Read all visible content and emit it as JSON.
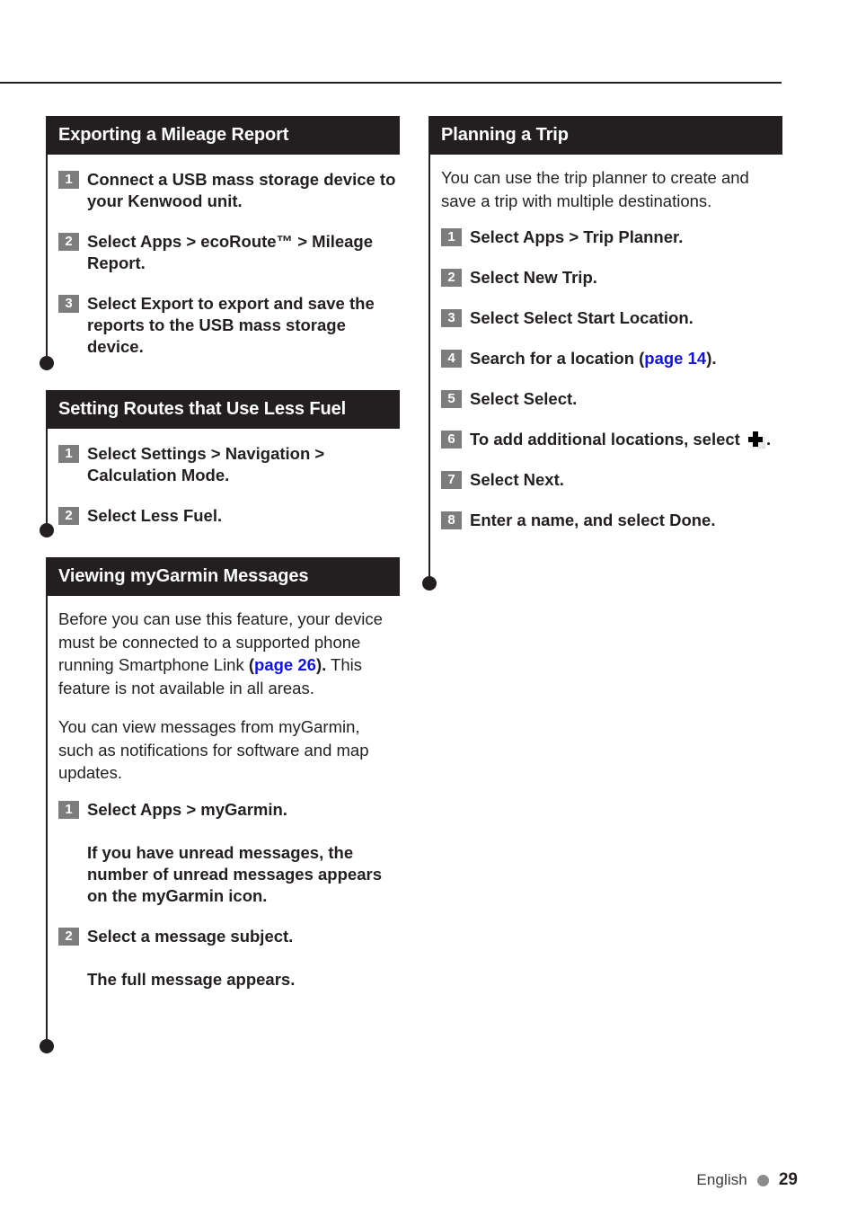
{
  "page": {
    "footer_language": "English",
    "footer_page_number": "29",
    "accent_link_color": "#1414d2",
    "header_bar_color": "#231f20",
    "step_badge_color": "#7d7d7d",
    "footer_dot_color": "#8c8c8c"
  },
  "left_column": {
    "sections": [
      {
        "title": "Exporting a Mileage Report",
        "steps": [
          {
            "num": "1",
            "text": "Connect a USB mass storage device to your Kenwood unit."
          },
          {
            "num": "2",
            "text": "Select Apps > ecoRoute™ > Mileage Report."
          },
          {
            "num": "3",
            "text": "Select Export to export and save the reports to the USB mass storage device."
          }
        ]
      },
      {
        "title": "Setting Routes that Use Less Fuel",
        "steps": [
          {
            "num": "1",
            "text": "Select Settings > Navigation > Calculation Mode."
          },
          {
            "num": "2",
            "text": "Select Less Fuel."
          }
        ]
      },
      {
        "title": "Viewing myGarmin Messages",
        "intro_1_before_link": "Before you can use this feature, your device must be connected to a supported phone running Smartphone Link ",
        "intro_1_paren_open": "(",
        "intro_1_link": "page 26",
        "intro_1_paren_close": ").",
        "intro_1_after_link": " This feature is not available in all areas.",
        "intro_2": "You can view messages from myGarmin, such as notifications for software and map updates.",
        "steps": [
          {
            "num": "1",
            "text": "Select Apps > myGarmin."
          }
        ],
        "note_1": "If you have unread messages, the number of unread messages appears on the myGarmin icon.",
        "steps_2": [
          {
            "num": "2",
            "text": "Select a message subject."
          }
        ],
        "note_2": "The full message appears."
      }
    ]
  },
  "right_column": {
    "sections": [
      {
        "title": "Planning a Trip",
        "intro": "You can use the trip planner to create and save a trip with multiple destinations.",
        "steps": [
          {
            "num": "1",
            "text": "Select Apps > Trip Planner."
          },
          {
            "num": "2",
            "text": "Select New Trip."
          },
          {
            "num": "3",
            "text": "Select Select Start Location."
          },
          {
            "num": "4",
            "text_before_link": "Search for a location (",
            "link": "page 14",
            "text_after_link": ")."
          },
          {
            "num": "5",
            "text": "Select Select."
          },
          {
            "num": "6",
            "text_before_icon": "To add additional locations, select ",
            "icon": "plus-icon",
            "text_after_icon": "."
          },
          {
            "num": "7",
            "text": "Select Next."
          },
          {
            "num": "8",
            "text": "Enter a name, and select Done."
          }
        ]
      }
    ]
  }
}
